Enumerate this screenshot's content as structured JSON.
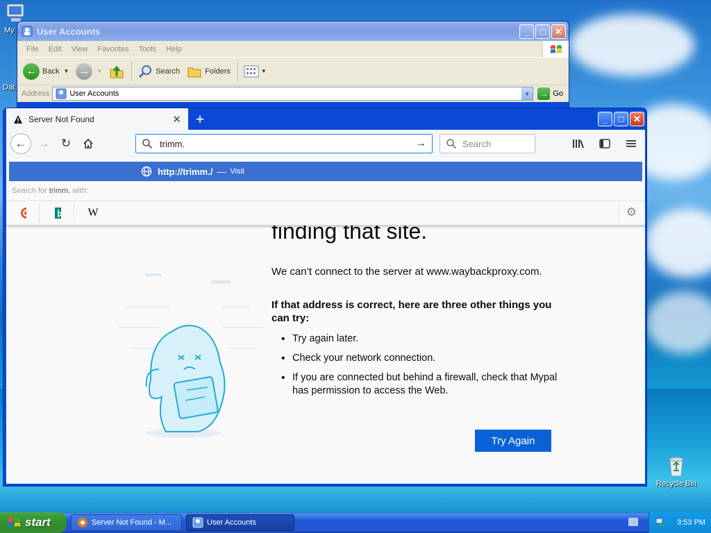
{
  "desktop": {
    "icons": [
      {
        "label": "My"
      },
      {
        "label": "Dat"
      },
      {
        "label": "Recycle Bin"
      }
    ]
  },
  "explorer": {
    "title": "User Accounts",
    "menu": [
      "File",
      "Edit",
      "View",
      "Favorites",
      "Tools",
      "Help"
    ],
    "toolbar": {
      "back_label": "Back",
      "search_label": "Search",
      "folders_label": "Folders"
    },
    "address": {
      "label": "Address",
      "value": "User Accounts",
      "go_label": "Go"
    }
  },
  "browser": {
    "tab_title": "Server Not Found",
    "url_text": "trimm.",
    "search_placeholder": "Search",
    "suggestion": {
      "url": "http://trimm./",
      "dash": "—",
      "action": "Visit"
    },
    "search_with": {
      "prefix": "Search for",
      "term": "trimm.",
      "suffix": "with:"
    },
    "page": {
      "title": "finding that site.",
      "intro": "We can’t connect to the server at www.waybackproxy.com.",
      "bold": "If that address is correct, here are three other things you can try:",
      "items": [
        "Try again later.",
        "Check your network connection.",
        "If you are connected but behind a firewall, check that Mypal has permission to access the Web."
      ],
      "button": "Try Again"
    }
  },
  "taskbar": {
    "start_label": "start",
    "tasks": [
      {
        "label": "Server Not Found - M..."
      },
      {
        "label": "User Accounts"
      }
    ],
    "clock": "3:53 PM"
  }
}
